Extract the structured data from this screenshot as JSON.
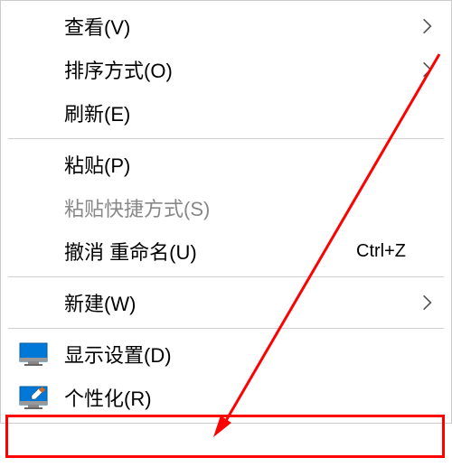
{
  "menu": {
    "view": {
      "label": "查看(V)",
      "hasSubmenu": true
    },
    "sort": {
      "label": "排序方式(O)",
      "hasSubmenu": true
    },
    "refresh": {
      "label": "刷新(E)"
    },
    "paste": {
      "label": "粘贴(P)"
    },
    "pasteShortcut": {
      "label": "粘贴快捷方式(S)",
      "disabled": true
    },
    "undo": {
      "label": "撤消 重命名(U)",
      "shortcut": "Ctrl+Z"
    },
    "new": {
      "label": "新建(W)",
      "hasSubmenu": true
    },
    "displaySettings": {
      "label": "显示设置(D)",
      "icon": "monitor"
    },
    "personalize": {
      "label": "个性化(R)",
      "icon": "personalize"
    }
  }
}
